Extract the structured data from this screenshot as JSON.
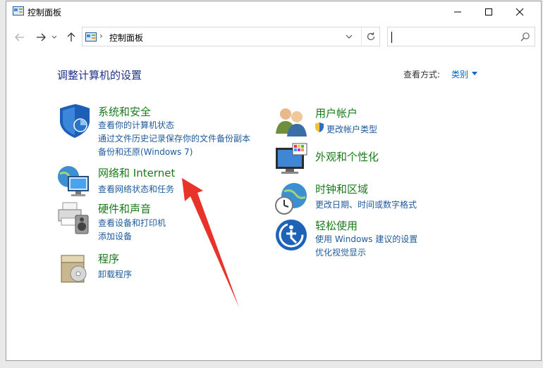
{
  "window": {
    "title": "控制面板"
  },
  "address": {
    "path_separator": "›",
    "path": "控制面板"
  },
  "search": {
    "placeholder": ""
  },
  "main": {
    "title": "调整计算机的设置",
    "view_by_label": "查看方式:",
    "view_by_value": "类别"
  },
  "categories": {
    "system": {
      "title": "系统和安全",
      "links": [
        "查看你的计算机状态",
        "通过文件历史记录保存你的文件备份副本",
        "备份和还原(Windows 7)"
      ]
    },
    "network": {
      "title": "网络和 Internet",
      "links": [
        "查看网络状态和任务"
      ]
    },
    "hardware": {
      "title": "硬件和声音",
      "links": [
        "查看设备和打印机",
        "添加设备"
      ]
    },
    "programs": {
      "title": "程序",
      "links": [
        "卸载程序"
      ]
    },
    "user": {
      "title": "用户帐户",
      "links": [
        "更改帐户类型"
      ]
    },
    "appearance": {
      "title": "外观和个性化",
      "links": []
    },
    "clock": {
      "title": "时钟和区域",
      "links": [
        "更改日期、时间或数字格式"
      ]
    },
    "ease": {
      "title": "轻松使用",
      "links": [
        "使用 Windows 建议的设置",
        "优化视觉显示"
      ]
    }
  },
  "colors": {
    "accent": "#0066cc",
    "category_title": "#1a7a1a",
    "link": "#1e5a9c",
    "annotation_arrow": "#e8332a"
  }
}
